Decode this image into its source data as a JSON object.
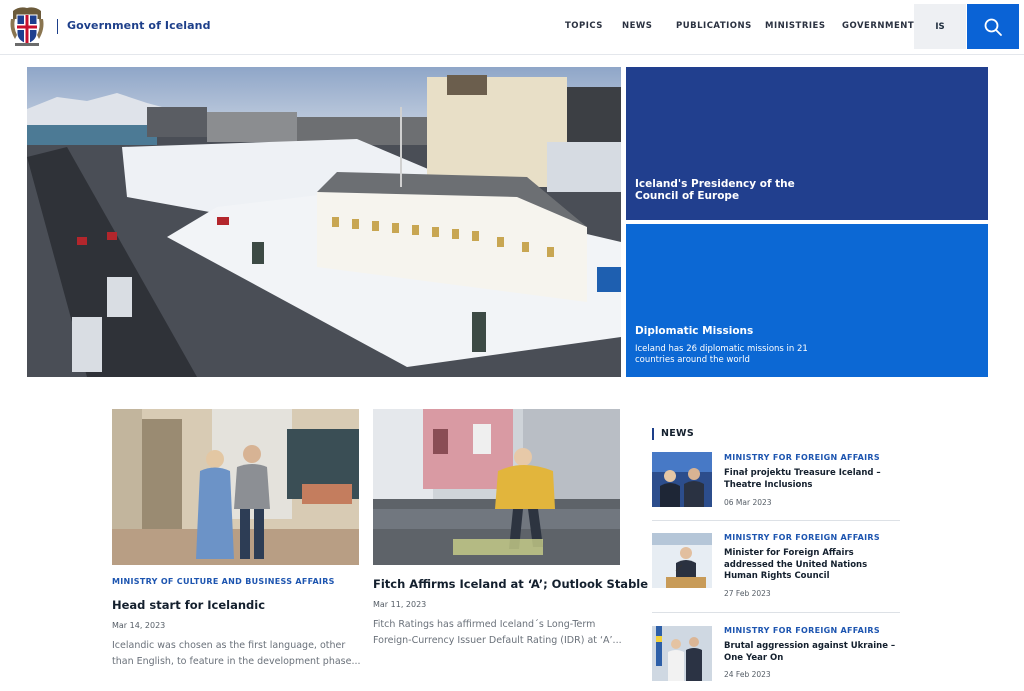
{
  "header": {
    "brand": "Government of Iceland",
    "nav": [
      "TOPICS",
      "NEWS",
      "PUBLICATIONS",
      "MINISTRIES",
      "GOVERNMENT"
    ],
    "lang_label": "IS"
  },
  "hero": {
    "tiles": [
      {
        "title": "Iceland's Presidency of the Council of Europe"
      },
      {
        "title": "Diplomatic Missions",
        "desc": "Iceland has 26 diplomatic missions in 21 countries around the world"
      }
    ]
  },
  "articles": [
    {
      "category": "MINISTRY OF CULTURE AND BUSINESS AFFAIRS",
      "title": "Head start for Icelandic",
      "date": "Mar 14, 2023",
      "text": "Icelandic was chosen as the first language, other than English, to feature in the development phase..."
    },
    {
      "title": "Fitch Affirms Iceland at ‘A’; Outlook Stable",
      "date": "Mar 11, 2023",
      "text": "Fitch Ratings has affirmed Iceland´s Long-Term Foreign-Currency Issuer Default Rating (IDR) at ‘A’..."
    }
  ],
  "news": {
    "heading": "NEWS",
    "items": [
      {
        "category": "MINISTRY FOR FOREIGN AFFAIRS",
        "title": "Finał projektu Treasure Iceland – Theatre Inclusions",
        "date": "06 Mar 2023"
      },
      {
        "category": "MINISTRY FOR FOREIGN AFFAIRS",
        "title": "Minister for Foreign Affairs addressed the United Nations Human Rights Council",
        "date": "27 Feb 2023"
      },
      {
        "category": "MINISTRY FOR FOREIGN AFFAIRS",
        "title": "Brutal aggression against Ukraine – One Year On",
        "date": "24 Feb 2023"
      }
    ]
  },
  "colors": {
    "brand_blue": "#1d3f8a",
    "tile_dark": "#213f8e",
    "tile_bright": "#0c68d4",
    "search_button": "#0a63d6",
    "category_text": "#1d55b0"
  },
  "icons": {
    "logo": "coat-of-arms-icon",
    "search": "search-icon"
  }
}
